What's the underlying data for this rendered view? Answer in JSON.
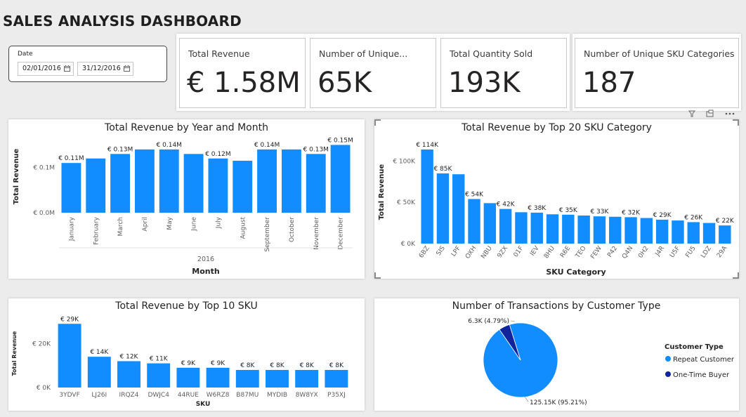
{
  "dashboard": {
    "title": "SALES ANALYSIS DASHBOARD"
  },
  "slicer": {
    "label": "Date",
    "start": "02/01/2016",
    "end": "31/12/2016"
  },
  "cards": [
    {
      "label": "Total Revenue",
      "value": "€ 1.58M"
    },
    {
      "label": "Number of Unique...",
      "value": "65K"
    },
    {
      "label": "Total Quantity Sold",
      "value": "193K"
    },
    {
      "label": "Number of Unique SKU Categories",
      "value": "187"
    }
  ],
  "colors": {
    "bar": "#118DFF",
    "dark": "#12239E"
  },
  "chart_data": [
    {
      "type": "bar",
      "title": "Total Revenue by Year and Month",
      "xlabel": "Month",
      "ylabel": "Total Revenue",
      "group_label": "2016",
      "categories": [
        "January",
        "February",
        "March",
        "April",
        "May",
        "June",
        "July",
        "August",
        "September",
        "October",
        "November",
        "December"
      ],
      "values": [
        0.11,
        0.12,
        0.13,
        0.14,
        0.14,
        0.13,
        0.12,
        0.115,
        0.14,
        0.14,
        0.13,
        0.15
      ],
      "data_labels": [
        "€ 0.11M",
        "",
        "€ 0.13M",
        "",
        "€ 0.14M",
        "",
        "€ 0.12M",
        "",
        "€ 0.14M",
        "",
        "€ 0.13M",
        "€ 0.15M"
      ],
      "yticks": [
        {
          "v": 0,
          "label": "€ 0.0M"
        },
        {
          "v": 0.1,
          "label": "€ 0.1M"
        }
      ],
      "ylim": [
        0,
        0.16
      ]
    },
    {
      "type": "bar",
      "title": "Total Revenue by Top 20 SKU Category",
      "xlabel": "SKU Category",
      "ylabel": "Total Revenue",
      "categories": [
        "6BZ",
        "SIS",
        "LPF",
        "OXH",
        "NBU",
        "9ZX",
        "01F",
        "IEV",
        "8HU",
        "R6E",
        "TEO",
        "FEW",
        "P42",
        "Q4N",
        "0H2",
        "J4R",
        "U5F",
        "FU5",
        "LDZ",
        "29A"
      ],
      "values": [
        114,
        85,
        84,
        54,
        49,
        42,
        38,
        37.5,
        35.5,
        35,
        34,
        33,
        32.5,
        32,
        31,
        29,
        28,
        26,
        25,
        22
      ],
      "data_labels": [
        "€ 114K",
        "€ 85K",
        "",
        "€ 54K",
        "",
        "€ 42K",
        "",
        "€ 38K",
        "",
        "€ 35K",
        "",
        "€ 33K",
        "",
        "€ 32K",
        "",
        "€ 29K",
        "",
        "€ 26K",
        "",
        "€ 22K"
      ],
      "yticks": [
        {
          "v": 0,
          "label": "€ 0K"
        },
        {
          "v": 50,
          "label": "€ 50K"
        },
        {
          "v": 100,
          "label": "€ 100K"
        }
      ],
      "ylim": [
        0,
        125
      ]
    },
    {
      "type": "bar",
      "title": "Total Revenue by Top 10 SKU",
      "xlabel": "SKU",
      "ylabel": "Total Revenue",
      "categories": [
        "3YDVF",
        "LJ26I",
        "IRQZ4",
        "DWJC4",
        "44RUE",
        "W6RZ8",
        "B87MU",
        "MYDIB",
        "8W8YX",
        "P35XJ"
      ],
      "values": [
        29,
        14,
        12,
        11,
        9,
        9,
        8,
        8,
        8,
        8
      ],
      "data_labels": [
        "€ 29K",
        "€ 14K",
        "€ 12K",
        "€ 11K",
        "€ 9K",
        "€ 9K",
        "€ 8K",
        "€ 8K",
        "€ 8K",
        "€ 8K"
      ],
      "yticks": [
        {
          "v": 0,
          "label": "€ 0K"
        },
        {
          "v": 20,
          "label": "€ 20K"
        }
      ],
      "ylim": [
        0,
        31
      ]
    },
    {
      "type": "pie",
      "title": "Number of Transactions by Customer Type",
      "legend_title": "Customer Type",
      "slices": [
        {
          "name": "Repeat Customer",
          "value": 125.15,
          "label": "125.15K (95.21%)",
          "color": "#118DFF"
        },
        {
          "name": "One-Time Buyer",
          "value": 6.3,
          "label": "6.3K (4.79%)",
          "color": "#12239E"
        }
      ]
    }
  ]
}
